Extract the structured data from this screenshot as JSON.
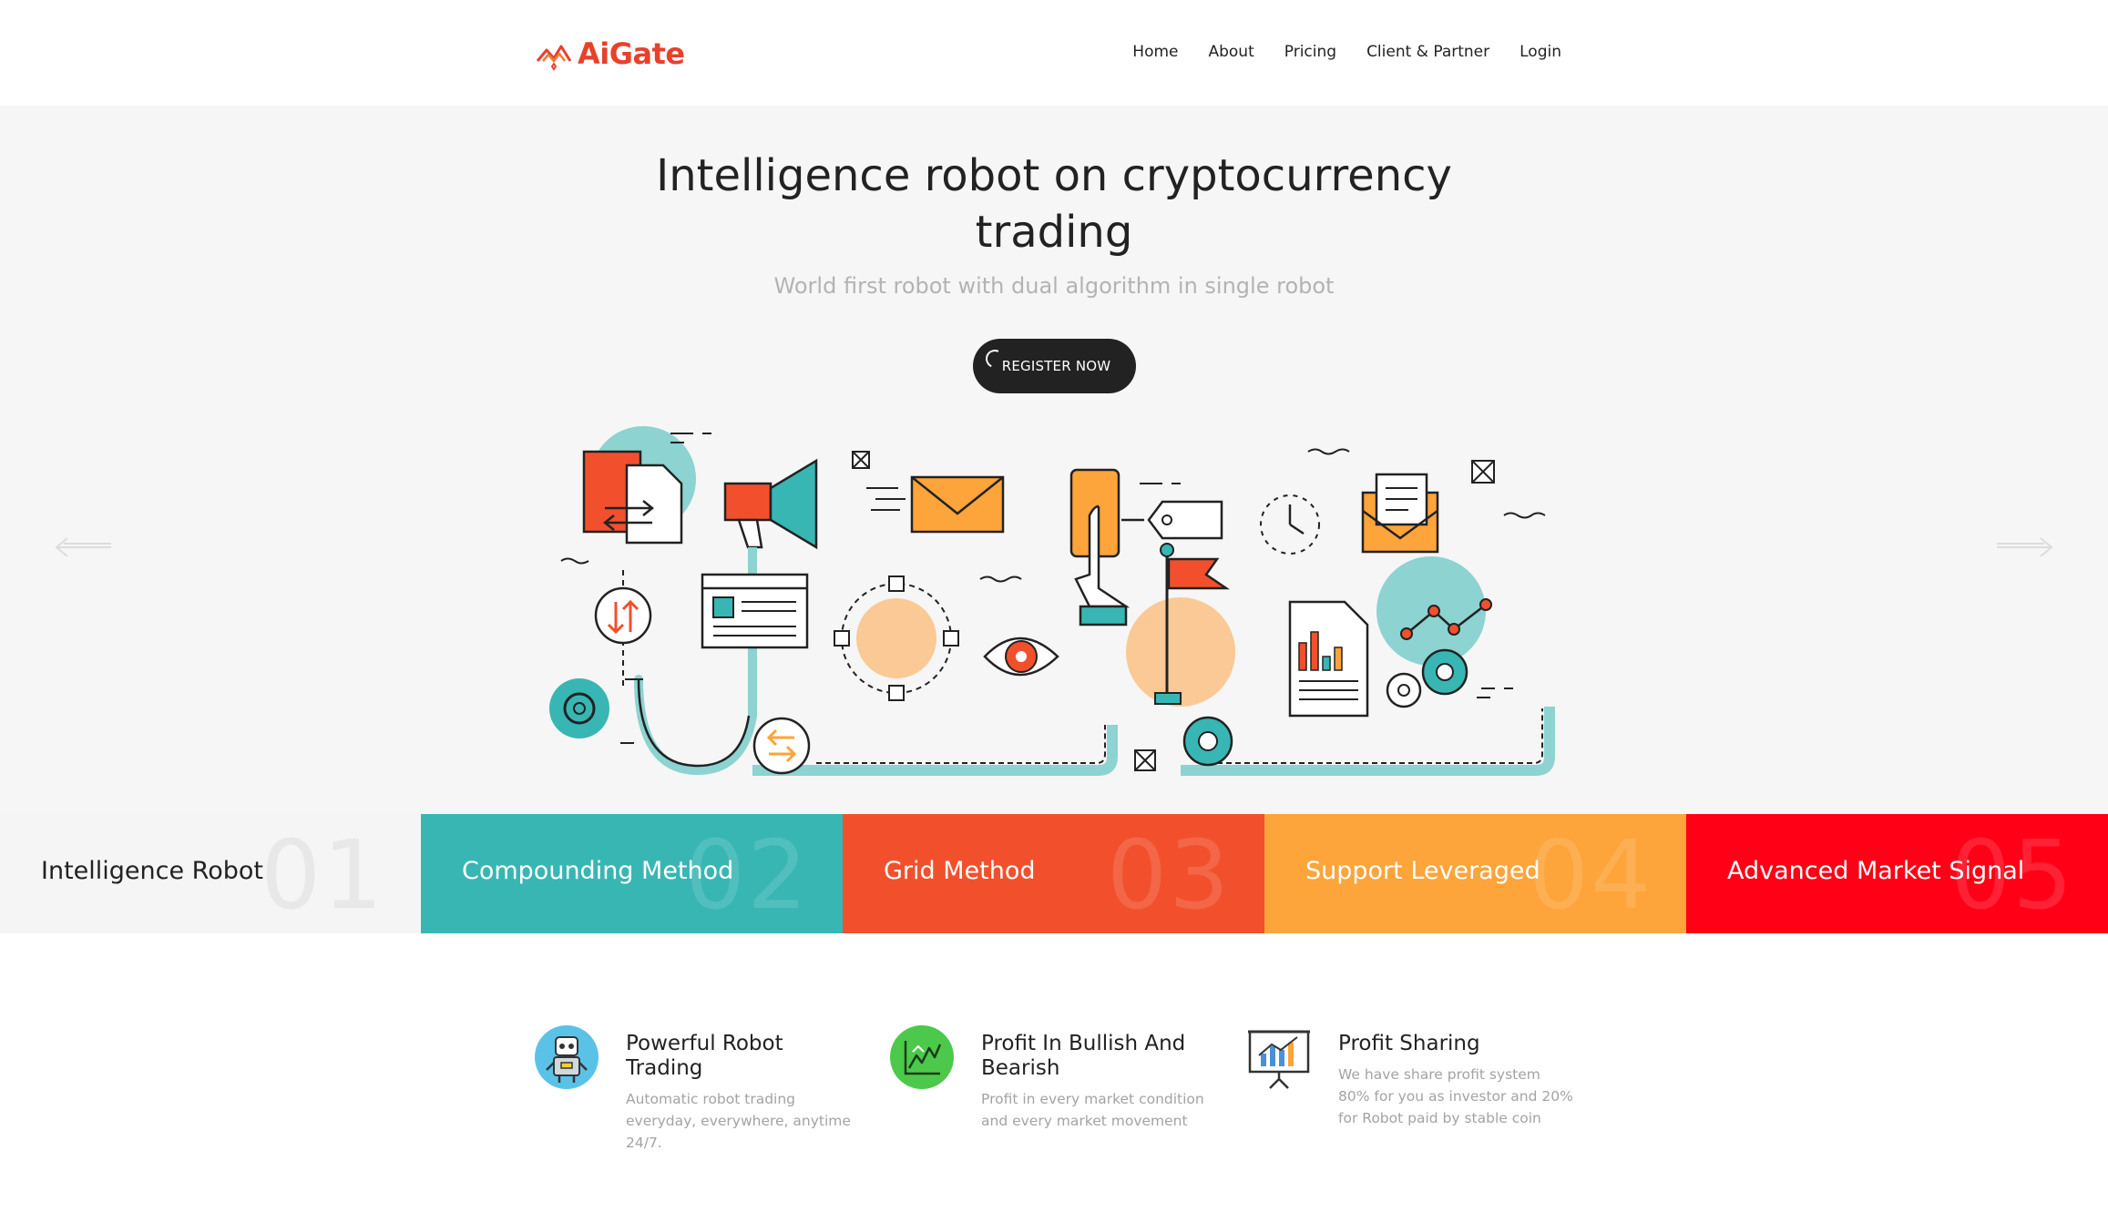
{
  "header": {
    "logo_text": "AiGate",
    "nav": [
      {
        "label": "Home"
      },
      {
        "label": "About"
      },
      {
        "label": "Pricing"
      },
      {
        "label": "Client & Partner"
      },
      {
        "label": "Login"
      }
    ]
  },
  "hero": {
    "title_line1": "Intelligence robot on cryptocurrency",
    "title_line2": "trading",
    "subtitle": "World first robot with dual algorithm in single robot",
    "register_label": "REGISTER NOW"
  },
  "tabs": [
    {
      "label": "Intelligence Robot",
      "number": "01",
      "color": "#f4f5f4"
    },
    {
      "label": "Compounding Method",
      "number": "02",
      "color": "#38b6b4"
    },
    {
      "label": "Grid Method",
      "number": "03",
      "color": "#f2502c"
    },
    {
      "label": "Support Leveraged",
      "number": "04",
      "color": "#fda43a"
    },
    {
      "label": "Advanced Market Signal",
      "number": "05",
      "color": "#ff0016"
    }
  ],
  "features": [
    {
      "title": "Powerful Robot Trading",
      "description": "Automatic robot trading everyday, everywhere, anytime 24/7.",
      "icon": "robot-icon"
    },
    {
      "title": "Profit In Bullish And Bearish",
      "description": "Profit in every market condition and every market movement",
      "icon": "chart-growth-icon"
    },
    {
      "title": "Profit Sharing",
      "description": "We have share profit system 80% for you as investor and 20% for Robot paid by stable coin",
      "icon": "presentation-board-icon"
    }
  ],
  "colors": {
    "brand": "#e8402c",
    "teal": "#38b6b4",
    "orange_red": "#f2502c",
    "orange": "#fda43a",
    "red": "#ff0016",
    "dark_button": "#222222"
  }
}
